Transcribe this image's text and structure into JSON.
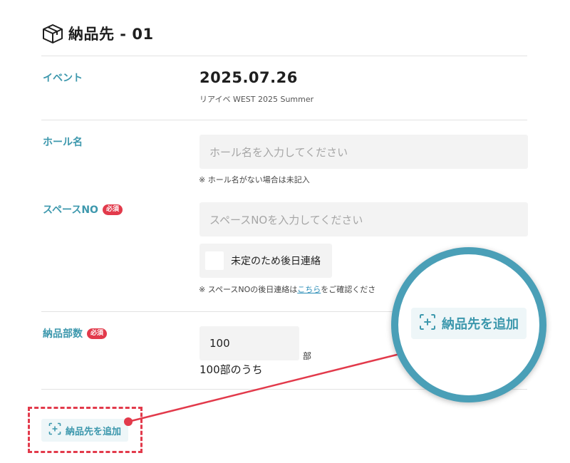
{
  "section": {
    "title": "納品先 - 01",
    "icon": "package-icon"
  },
  "event": {
    "label": "イベント",
    "date": "2025.07.26",
    "name": "リアイベ WEST 2025 Summer"
  },
  "hall": {
    "label": "ホール名",
    "placeholder": "ホール名を入力してください",
    "note": "※ ホール名がない場合は未記入"
  },
  "space": {
    "label": "スペースNO",
    "required_badge": "必須",
    "placeholder": "スペースNOを入力してください",
    "checkbox_label": "未定のため後日連絡",
    "note_prefix": "※ スペースNOの後日連絡は",
    "note_link": "こちら",
    "note_suffix": "をご確認くださ"
  },
  "quantity": {
    "label": "納品部数",
    "required_badge": "必須",
    "value": "100",
    "unit": "部",
    "total_text": "100部のうち"
  },
  "add_destination": {
    "label": "納品先を追加",
    "icon": "add-square-icon"
  },
  "colors": {
    "accent": "#3d98ad",
    "required": "#e23a4b",
    "highlight_frame": "#e23a4b",
    "magnifier_ring": "#4a9fb7"
  }
}
